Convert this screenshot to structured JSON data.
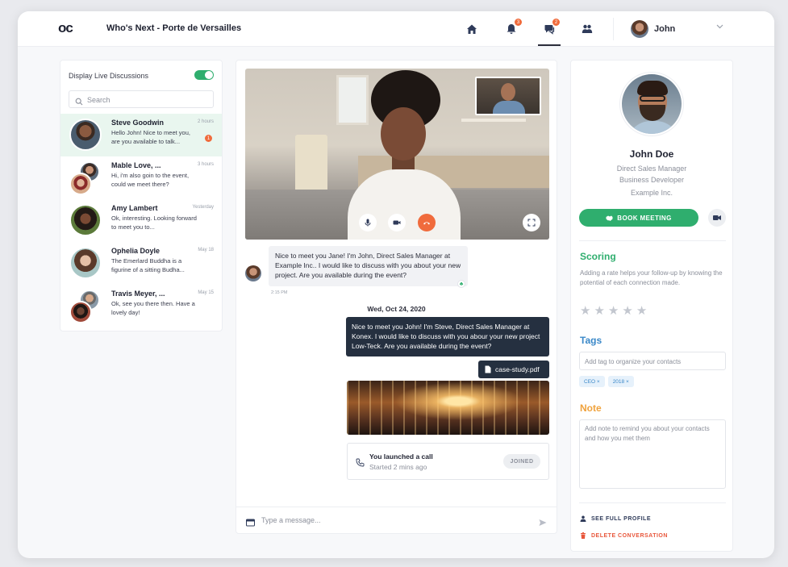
{
  "header": {
    "logo": "oc",
    "event_title": "Who's Next - Porte de Versailles",
    "nav": [
      {
        "name": "home-icon",
        "badge": ""
      },
      {
        "name": "bell-icon",
        "badge": "3"
      },
      {
        "name": "chat-icon",
        "badge": "2"
      },
      {
        "name": "people-icon",
        "badge": ""
      }
    ],
    "user_name": "John"
  },
  "sidebar": {
    "toggle_label": "Display Live Discussions",
    "toggle_on": true,
    "search_placeholder": "Search",
    "conversations": [
      {
        "name": "Steve Goodwin",
        "time": "2 hours",
        "text": "Hello John! Nice to meet you, are you available to talk...",
        "unread": "1",
        "active": true
      },
      {
        "name": "Mable Love, ...",
        "time": "3 hours",
        "text": "Hi, i'm also goin to the event, could we meet there?",
        "unread": "",
        "active": false
      },
      {
        "name": "Amy Lambert",
        "time": "Yesterday",
        "text": "Ok, interesting. Looking forward to meet you to...",
        "unread": "",
        "active": false
      },
      {
        "name": "Ophelia Doyle",
        "time": "May 18",
        "text": "The Emerlard Buddha is a figurine of a sitting Budha...",
        "unread": "",
        "active": false
      },
      {
        "name": "Travis Meyer, ...",
        "time": "May 15",
        "text": "Ok, see you there then. Have a lovely day!",
        "unread": "",
        "active": false
      }
    ]
  },
  "chat": {
    "incoming_message": "Nice to meet you Jane! I'm John, Direct Sales Manager at Example Inc.. I would like to discuss with you about your new project. Are you available during the event?",
    "incoming_time": "2:15 PM",
    "date_separator": "Wed, Oct 24, 2020",
    "outgoing_message": "Nice to meet you John! I'm Steve, Direct Sales Manager at Konex. I would like to discuss with you abour your new project Low-Teck. Are you available during the event?",
    "file_name": "case-study.pdf",
    "call_title": "You launched a call",
    "call_subtitle": "Started 2 mins ago",
    "call_status": "JOINED",
    "composer_placeholder": "Type a message..."
  },
  "profile": {
    "name": "John Doe",
    "role_lines": [
      "Direct Sales Manager",
      "Business Developer",
      "Example Inc."
    ],
    "book_button": "BOOK MEETING",
    "scoring_title": "Scoring",
    "scoring_desc": "Adding a rate helps your follow-up by knowing the potential of each connection made.",
    "rating": 0,
    "rating_max": 5,
    "tags_title": "Tags",
    "tag_placeholder": "Add tag to organize your contacts",
    "tags": [
      "CEO ×",
      "2018 ×"
    ],
    "note_title": "Note",
    "note_placeholder": "Add note to remind you about your contacts and how you met them",
    "see_profile": "SEE FULL PROFILE",
    "delete_conversation": "DELETE CONVERSATION"
  },
  "colors": {
    "accent_green": "#2fae6e",
    "accent_orange": "#f06b3c",
    "dark_bubble": "#253040",
    "tags_blue": "#3a88c8",
    "note_orange": "#f0a23c",
    "danger_red": "#e8573c"
  }
}
